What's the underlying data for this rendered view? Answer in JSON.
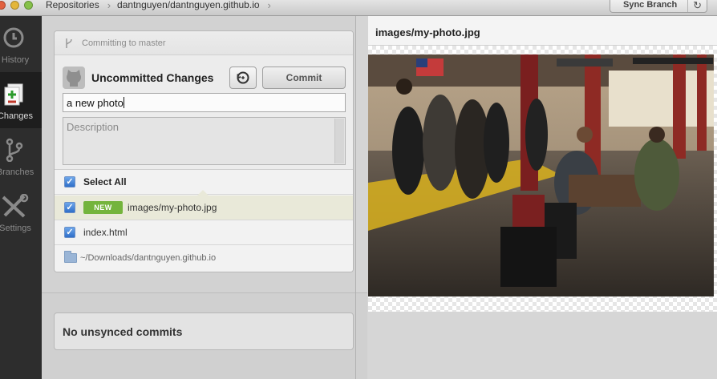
{
  "titlebar": {
    "crumbs": [
      "Repositories",
      "dantnguyen/dantnguyen.github.io"
    ],
    "sync_label": "Sync Branch"
  },
  "nav": {
    "items": [
      {
        "label": "History",
        "icon": "clock-icon"
      },
      {
        "label": "Changes",
        "icon": "changes-icon",
        "active": true
      },
      {
        "label": "Branches",
        "icon": "branch-icon"
      },
      {
        "label": "Settings",
        "icon": "tools-icon"
      }
    ]
  },
  "commit_panel": {
    "branch_text": "Committing to master",
    "title": "Uncommitted Changes",
    "commit_label": "Commit",
    "summary_value": "a new photo",
    "description_placeholder": "Description",
    "select_all_label": "Select All",
    "files": [
      {
        "name": "images/my-photo.jpg",
        "badge": "NEW",
        "checked": true,
        "selected": true
      },
      {
        "name": "index.html",
        "checked": true
      }
    ],
    "repo_path": "~/Downloads/dantnguyen.github.io"
  },
  "unsynced": {
    "label": "No unsynced commits"
  },
  "preview": {
    "filename": "images/my-photo.jpg",
    "image_description_icon": "photo-preview"
  },
  "colors": {
    "accent_blue": "#2f6fc9",
    "new_badge": "#74b43c",
    "nav_bg": "#2d2d2d"
  }
}
